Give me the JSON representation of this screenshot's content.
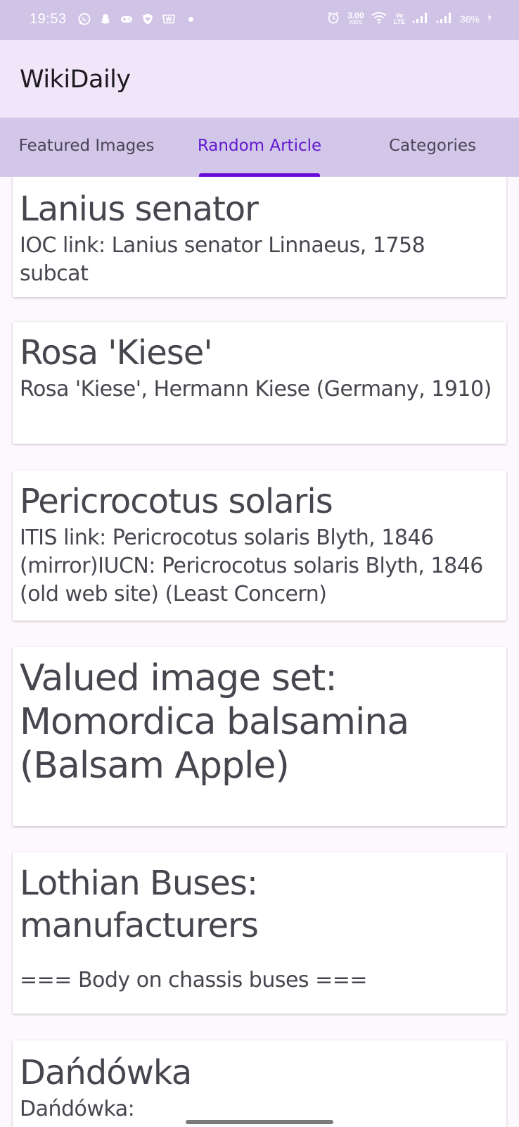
{
  "status_bar": {
    "time": "19:53",
    "left_icons": [
      "whatsapp-icon",
      "snapchat-icon",
      "game-controller-icon",
      "shield-heart-icon",
      "payment-app-icon"
    ],
    "speed_value": "3.00",
    "speed_unit": "KB/S",
    "volte_top": "Vo",
    "volte_bottom": "LTE",
    "battery": "36%"
  },
  "app_bar": {
    "title": "WikiDaily"
  },
  "tabs": [
    {
      "label": "Featured Images",
      "active": false
    },
    {
      "label": "Random Article",
      "active": true
    },
    {
      "label": "Categories",
      "active": false
    }
  ],
  "articles": [
    {
      "title": "Lanius senator",
      "description": "IOC link: Lanius senator  Linnaeus, 1758 subcat"
    },
    {
      "title": "Rosa 'Kiese'",
      "description": "Rosa 'Kiese', Hermann Kiese (Germany, 1910)"
    },
    {
      "title": "Pericrocotus solaris",
      "description": "ITIS link: Pericrocotus solaris  Blyth, 1846 (mirror)IUCN:  Pericrocotus solaris Blyth, 1846  (old web site) (Least Concern)"
    },
    {
      "title": "Valued image set: Momordica balsamina (Balsam Apple)",
      "description": ""
    },
    {
      "title": "Lothian Buses: manufacturers",
      "description": "=== Body on chassis buses ==="
    },
    {
      "title": "Dańdówka",
      "description": "Dańdówka:"
    }
  ],
  "colors": {
    "status_bar": "#cfc4e6",
    "app_bar": "#f1e5f9",
    "tab_bar": "#d2c7e8",
    "active_tab": "#6219d1",
    "indicator": "#6a0bd8",
    "background": "#fdf8fd"
  }
}
